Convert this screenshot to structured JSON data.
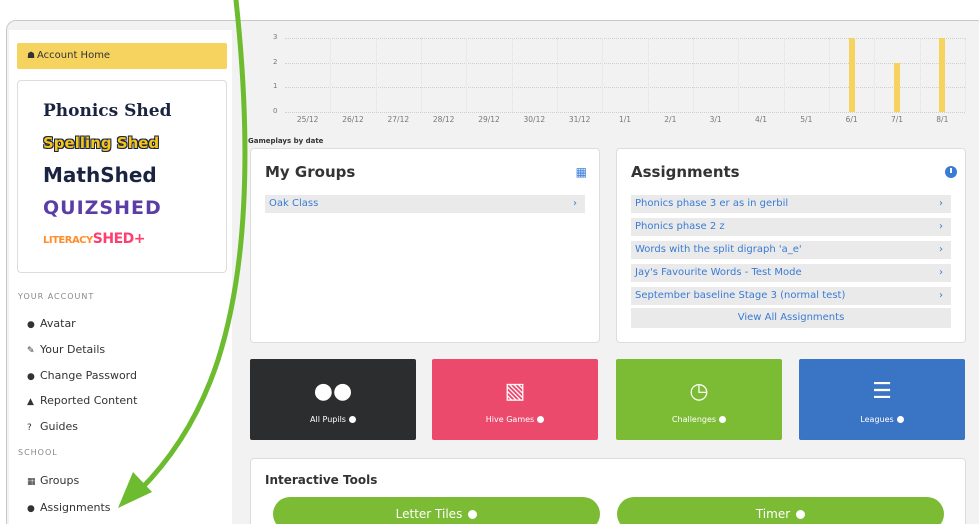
{
  "sidebar": {
    "account_home": "Account Home",
    "brands": [
      "Phonics Shed",
      "Spelling Shed",
      "MathShed",
      "QUIZSHED",
      "LITERACY",
      "SHED+"
    ],
    "your_account_heading": "YOUR ACCOUNT",
    "account_items": [
      "Avatar",
      "Your Details",
      "Change Password",
      "Reported Content",
      "Guides"
    ],
    "school_heading": "SCHOOL",
    "school_items": [
      "Groups",
      "Assignments"
    ]
  },
  "chart_data": {
    "type": "bar",
    "title": "",
    "xlabel": "Gameplays by date",
    "ylabel": "",
    "ylim": [
      0,
      3
    ],
    "yticks": [
      "0",
      "1",
      "2",
      "3"
    ],
    "categories": [
      "25/12",
      "26/12",
      "27/12",
      "28/12",
      "29/12",
      "30/12",
      "31/12",
      "1/1",
      "2/1",
      "3/1",
      "4/1",
      "5/1",
      "6/1",
      "7/1",
      "8/1"
    ],
    "values": [
      0,
      0,
      0,
      0,
      0,
      0,
      0,
      0,
      0,
      0,
      0,
      0,
      3,
      2,
      3
    ],
    "bar_color": "#f6d35f",
    "grid": true
  },
  "my_groups": {
    "title": "My Groups",
    "items": [
      "Oak Class"
    ]
  },
  "assignments": {
    "title": "Assignments",
    "items": [
      "Phonics phase 3 er as in gerbil",
      "Phonics phase 2 z",
      "Words with the split digraph 'a_e'",
      "Jay's Favourite Words - Test Mode",
      "September baseline Stage 3 (normal test)"
    ],
    "view_all": "View All Assignments"
  },
  "tiles": [
    {
      "label": "All Pupils",
      "color": "#2b2d2f",
      "icon": "users-icon"
    },
    {
      "label": "Hive Games",
      "color": "#ec4a6d",
      "icon": "hierarchy-icon"
    },
    {
      "label": "Challenges",
      "color": "#7cbc35",
      "icon": "clock-icon"
    },
    {
      "label": "Leagues",
      "color": "#3a74c5",
      "icon": "list-icon"
    }
  ],
  "tools": {
    "title": "Interactive Tools",
    "items": [
      "Letter Tiles",
      "Timer"
    ]
  },
  "chevron": "›",
  "colors": {
    "accent": "#3a7bd5",
    "highlight": "#f6d35f",
    "arrow": "#6dbb2e"
  }
}
